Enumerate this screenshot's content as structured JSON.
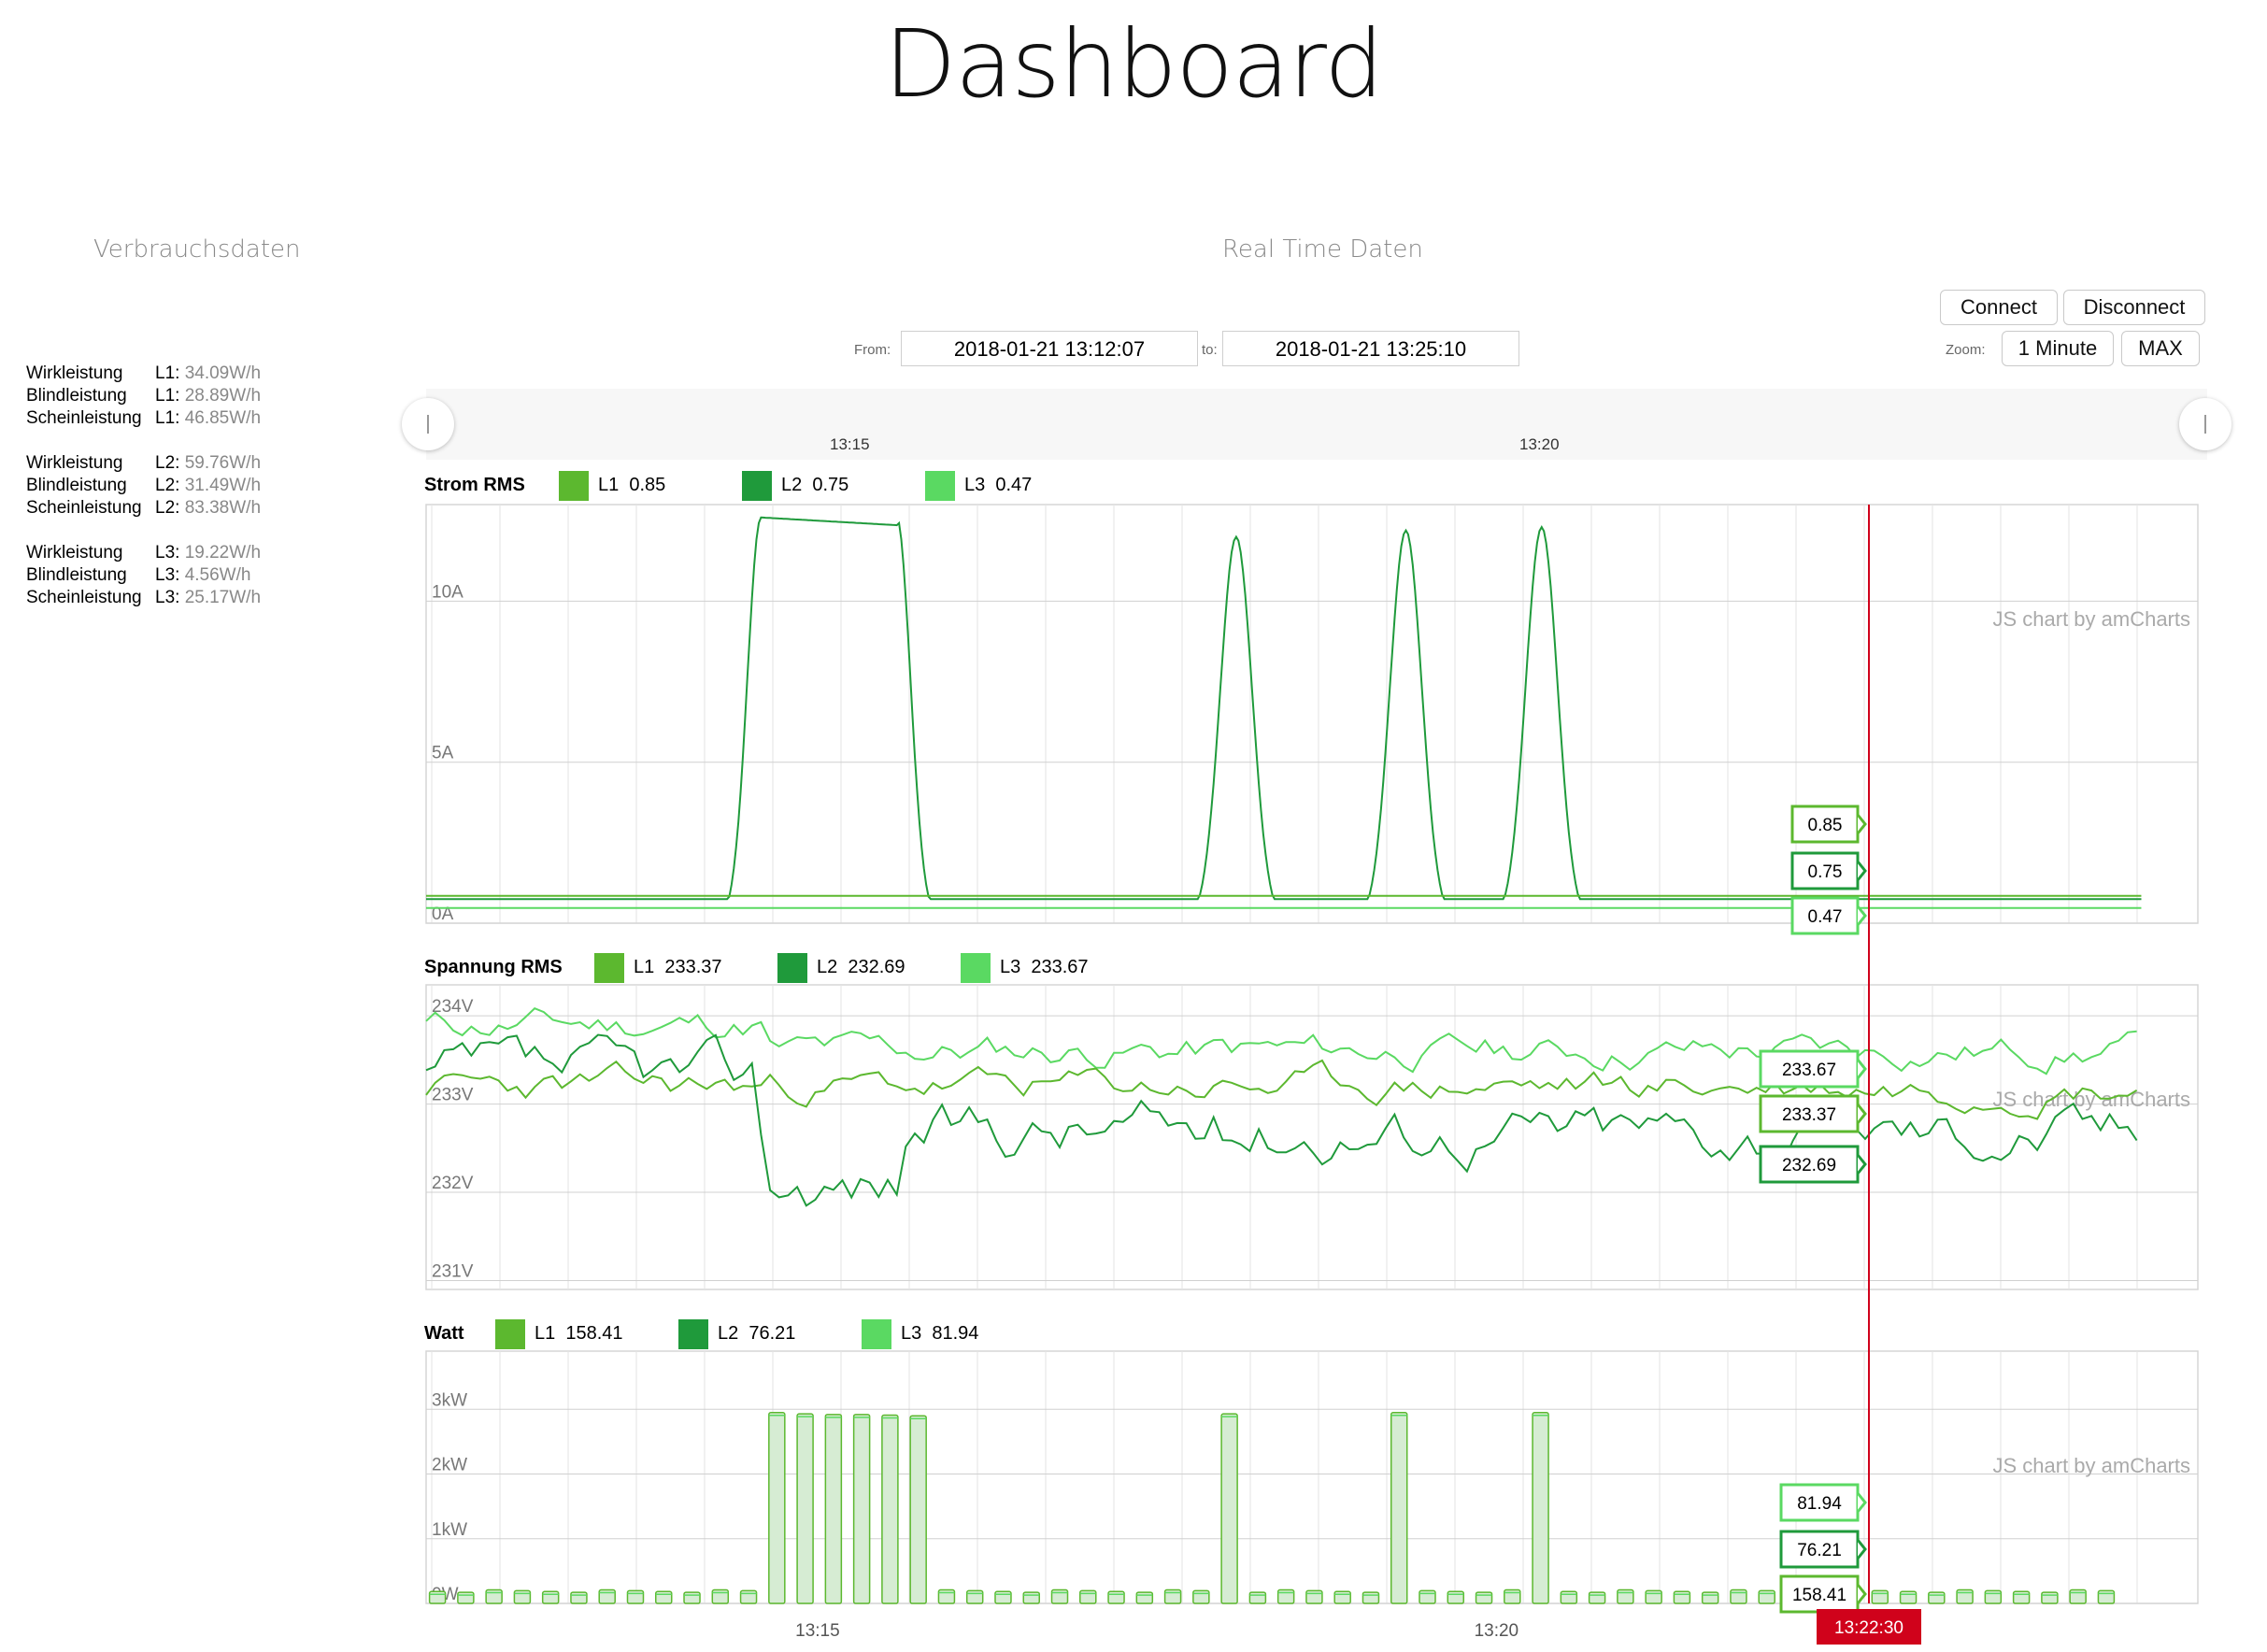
{
  "title": "Dashboard",
  "consumption": {
    "heading": "Verbrauchsdaten",
    "groups": [
      {
        "rows": [
          {
            "label": "Wirkleistung",
            "phase": "L1:",
            "value": "34.09W/h"
          },
          {
            "label": "Blindleistung",
            "phase": "L1:",
            "value": "28.89W/h"
          },
          {
            "label": "Scheinleistung",
            "phase": "L1:",
            "value": "46.85W/h"
          }
        ]
      },
      {
        "rows": [
          {
            "label": "Wirkleistung",
            "phase": "L2:",
            "value": "59.76W/h"
          },
          {
            "label": "Blindleistung",
            "phase": "L2:",
            "value": "31.49W/h"
          },
          {
            "label": "Scheinleistung",
            "phase": "L2:",
            "value": "83.38W/h"
          }
        ]
      },
      {
        "rows": [
          {
            "label": "Wirkleistung",
            "phase": "L3:",
            "value": "19.22W/h"
          },
          {
            "label": "Blindleistung",
            "phase": "L3:",
            "value": "4.56W/h"
          },
          {
            "label": "Scheinleistung",
            "phase": "L3:",
            "value": "25.17W/h"
          }
        ]
      }
    ]
  },
  "realtime": {
    "heading": "Real Time Daten",
    "from_label": "From:",
    "from_value": "2018-01-21 13:12:07",
    "to_label": "to:",
    "to_value": "2018-01-21 13:25:10",
    "connect_label": "Connect",
    "disconnect_label": "Disconnect",
    "zoom_label": "Zoom:",
    "zoom_options": [
      "1 Minute",
      "MAX"
    ]
  },
  "scrollbar": {
    "ticks": [
      "13:15",
      "13:20"
    ]
  },
  "colors": {
    "L1": "#5cb82f",
    "L2": "#1f9a3b",
    "L3": "#5ad962",
    "cursor": "#d0021b",
    "grid": "#e3e3e3",
    "watermark": "#aaaaaa"
  },
  "watermark": "JS chart by amCharts",
  "cursor_time": "13:22:30",
  "x_axis_ticks": [
    "13:15",
    "13:20"
  ],
  "chart_data": [
    {
      "type": "line",
      "title": "Strom RMS",
      "ylim": [
        0,
        13
      ],
      "y_ticks": [
        "0A",
        "5A",
        "10A"
      ],
      "x_range": [
        "13:12:07",
        "13:25:10"
      ],
      "series": [
        {
          "name": "L1",
          "legend_value": "0.85"
        },
        {
          "name": "L2",
          "legend_value": "0.75"
        },
        {
          "name": "L3",
          "legend_value": "0.47"
        }
      ],
      "balloons": [
        "0.85",
        "0.75",
        "0.47"
      ],
      "key_points": {
        "L2_spikes": [
          {
            "start": "13:14:35",
            "end": "13:15:35",
            "peak": 12.6
          },
          {
            "time": "13:18:05",
            "peak": 12.0
          },
          {
            "time": "13:19:20",
            "peak": 12.2
          },
          {
            "time": "13:20:20",
            "peak": 12.3
          }
        ],
        "baseline_L1": 0.85,
        "baseline_L2": 0.75,
        "baseline_L3": 0.47
      }
    },
    {
      "type": "line",
      "title": "Spannung RMS",
      "ylim": [
        231,
        234.3
      ],
      "y_ticks": [
        "231V",
        "232V",
        "233V",
        "234V"
      ],
      "series": [
        {
          "name": "L1",
          "legend_value": "233.37"
        },
        {
          "name": "L2",
          "legend_value": "232.69"
        },
        {
          "name": "L3",
          "legend_value": "233.67"
        }
      ],
      "balloons": [
        "233.67",
        "233.37",
        "232.69"
      ]
    },
    {
      "type": "bar",
      "title": "Watt",
      "ylim": [
        0,
        3200
      ],
      "y_ticks": [
        "0W",
        "1kW",
        "2kW",
        "3kW"
      ],
      "series": [
        {
          "name": "L1",
          "legend_value": "158.41"
        },
        {
          "name": "L2",
          "legend_value": "76.21"
        },
        {
          "name": "L3",
          "legend_value": "81.94"
        }
      ],
      "balloons": [
        "81.94",
        "76.21",
        "158.41"
      ],
      "high_bars_kW": [
        {
          "time": "13:14:45",
          "value": 2950
        },
        {
          "time": "13:15:00",
          "value": 2930
        },
        {
          "time": "13:15:10",
          "value": 2920
        },
        {
          "time": "13:15:20",
          "value": 2920
        },
        {
          "time": "13:15:30",
          "value": 2910
        },
        {
          "time": "13:15:40",
          "value": 2900
        },
        {
          "time": "13:18:05",
          "value": 2930
        },
        {
          "time": "13:19:15",
          "value": 2950
        },
        {
          "time": "13:20:20",
          "value": 2950
        }
      ]
    }
  ]
}
